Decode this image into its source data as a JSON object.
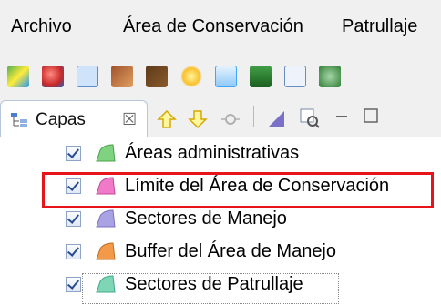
{
  "menu": {
    "items": [
      "Archivo",
      "Área de Conservación",
      "Patrullaje"
    ]
  },
  "toolbar": {
    "icons": [
      "map-icon",
      "layers-icon",
      "grid-icon",
      "hand-icon",
      "footprints-icon",
      "bulb-icon",
      "form-icon",
      "tree-icon",
      "list-icon",
      "refresh-icon"
    ]
  },
  "view": {
    "tab_label": "Capas",
    "tab_close": "☒"
  },
  "layers": [
    {
      "label": "Áreas administrativas",
      "color": "#7fd27f",
      "checked": true
    },
    {
      "label": "Límite del Área de Conservación",
      "color": "#f07ac8",
      "checked": true
    },
    {
      "label": "Sectores de Manejo",
      "color": "#a9a3e3",
      "checked": true
    },
    {
      "label": "Buffer del Área de Manejo",
      "color": "#f39a4a",
      "checked": true
    },
    {
      "label": "Sectores de Patrullaje",
      "color": "#7fd6b7",
      "checked": true
    }
  ],
  "highlight_color": "#e8141b"
}
